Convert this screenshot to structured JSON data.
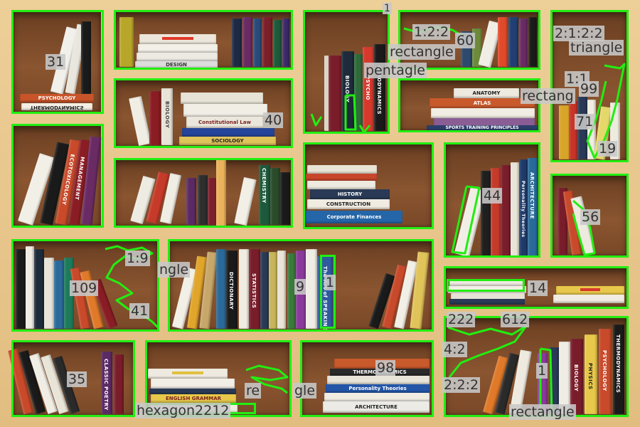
{
  "book_titles": {
    "psychology": "PSYCHOLOGY",
    "thermodynamics": "THERMODYNAMICS",
    "design": "DESIGN",
    "sociology": "SOCIOLOGY",
    "constitutional_law": "Constitutional Law",
    "biology": "BIOLOGY",
    "psychology_short": "PSYCHO",
    "aerodynamics": "AERODYNAMICS",
    "anatomy": "ANATOMY",
    "atlas": "ATLAS",
    "sports": "SPORTS TRAINING PRINCIPLES",
    "ecotoxicology": "ECOTOXICOLOGY",
    "management": "MANAGEMENT",
    "chemistry": "CHEMISTRY",
    "history": "HISTORY",
    "construction": "CONSTRUCTION",
    "corporate_finances": "Corporate Finances",
    "architecture": "ARCHITECTURE",
    "personality": "Personality Theories",
    "dictionary": "DICTIONARY",
    "statistics": "STATISTICS",
    "the_art_of_speaking": "The Art of SPEAKING",
    "anatomy_v": "ANATOMY",
    "classic_poetry": "CLASSIC POETRY",
    "aerodynamics_2": "AERODYNAMICS",
    "physics": "PHYSICS",
    "architecture_2": "ARCHITECTURE",
    "english_grammar": "ENGLISH GRAMMAR",
    "psychology_r": "PSYCHOLOGY"
  },
  "annotations": [
    {
      "id": "l1",
      "text": "31"
    },
    {
      "id": "l2",
      "text": "40"
    },
    {
      "id": "l3",
      "text": "1"
    },
    {
      "id": "l4",
      "text": "1:2:2"
    },
    {
      "id": "l5",
      "text": "60"
    },
    {
      "id": "l6",
      "text": "rectangle"
    },
    {
      "id": "l7",
      "text": "pentagle"
    },
    {
      "id": "l8",
      "text": "2:1:2:2"
    },
    {
      "id": "l9",
      "text": "triangle"
    },
    {
      "id": "l10",
      "text": "rectang"
    },
    {
      "id": "l11",
      "text": "1:1"
    },
    {
      "id": "l12",
      "text": "99"
    },
    {
      "id": "l13",
      "text": "71"
    },
    {
      "id": "l14",
      "text": "19"
    },
    {
      "id": "l15",
      "text": "44"
    },
    {
      "id": "l16",
      "text": "56"
    },
    {
      "id": "l17",
      "text": "1:9"
    },
    {
      "id": "l18",
      "text": "ngle"
    },
    {
      "id": "l19",
      "text": "109"
    },
    {
      "id": "l20",
      "text": "41"
    },
    {
      "id": "l21",
      "text": "9"
    },
    {
      "id": "l22",
      "text": "1"
    },
    {
      "id": "l23",
      "text": "14"
    },
    {
      "id": "l24",
      "text": "222"
    },
    {
      "id": "l25",
      "text": "612"
    },
    {
      "id": "l26",
      "text": "35"
    },
    {
      "id": "l27",
      "text": "98"
    },
    {
      "id": "l28",
      "text": "re"
    },
    {
      "id": "l29",
      "text": "gle"
    },
    {
      "id": "l30",
      "text": "hexagon2212"
    },
    {
      "id": "l31",
      "text": "rectangle"
    },
    {
      "id": "l32",
      "text": "2:2:2"
    },
    {
      "id": "l33",
      "text": "4:2"
    },
    {
      "id": "l34",
      "text": "1"
    }
  ],
  "colors": {
    "annotation_green": "#22ee11",
    "label_bg": "#c8c8c8",
    "shelf_wood": "#e9c78f",
    "cell_wood": "#7a4828"
  }
}
